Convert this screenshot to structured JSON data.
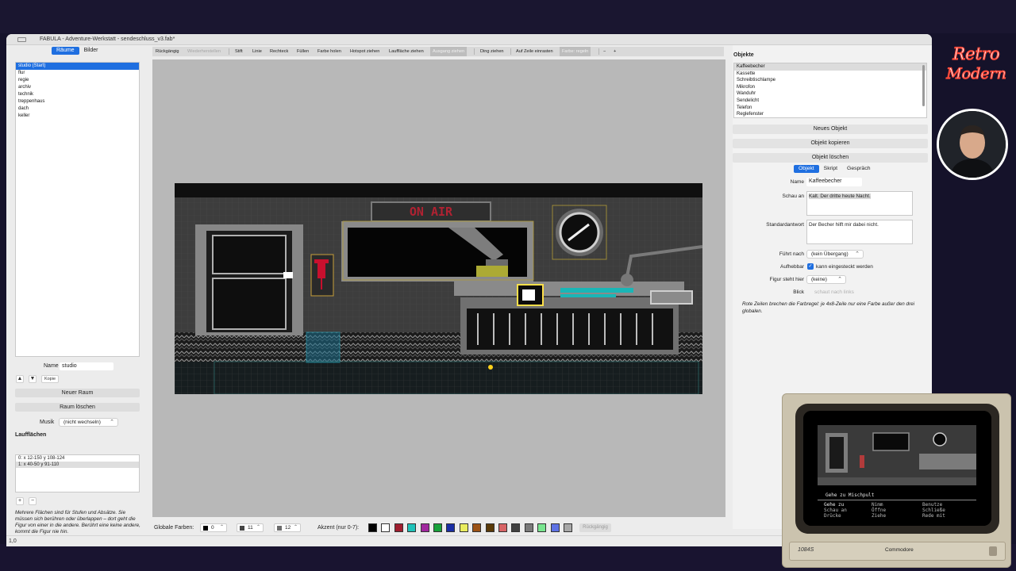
{
  "window": {
    "title": "FABULA - Adventure-Werkstatt - sendeschluss_v3.fab*"
  },
  "left_panel": {
    "tabs": [
      "Räume",
      "Bilder"
    ],
    "rooms": [
      "studio  (Start)",
      "flur",
      "regie",
      "archiv",
      "technik",
      "treppenhaus",
      "dach",
      "keller"
    ],
    "name_label": "Name",
    "name_value": "studio",
    "up_button": "▲",
    "down_button": "▼",
    "copy_button": "Kopie",
    "new_room_button": "Neuer Raum",
    "delete_room_button": "Raum löschen",
    "music_label": "Musik",
    "music_value": "(nicht wechseln)",
    "walkareas_title": "Laufflächen",
    "walkareas": [
      "0:  x 12-150   y 108-124",
      "1:  x 40-50   y 91-110"
    ],
    "add_area": "+",
    "remove_area": "−",
    "help_text": "Mehrere Flächen sind für Stufen und Absätze. Sie müssen sich berühren oder überlappen – dort geht die Figur von einer in die andere. Berührt eine keine andere, kommt die Figur nie hin."
  },
  "toolbar": {
    "undo": "Rückgängig",
    "redo": "Wiederherstellen",
    "tools": [
      "Stift",
      "Linie",
      "Rechteck",
      "Füllen",
      "Farbe holen",
      "Hotspot ziehen",
      "Lauffläche ziehen",
      "Ausgang ziehen"
    ],
    "drag_object": "Ding ziehen",
    "fit_row": "Auf Zeile einrasten",
    "color_rule": "Farbe: regeln",
    "zoom_out": "−",
    "zoom_in": "+"
  },
  "scene": {
    "sign_text": "ON AIR"
  },
  "bottom_bar": {
    "global_colors_label": "Globale Farben:",
    "global_colors": [
      {
        "value": "0",
        "color": "#000000"
      },
      {
        "value": "11",
        "color": "#444444"
      },
      {
        "value": "12",
        "color": "#6c6c6c"
      }
    ],
    "accent_label": "Akzent (nur 0-7):",
    "palette": [
      "#000000",
      "#ffffff",
      "#9f1d2e",
      "#1fc2b9",
      "#a0289e",
      "#18a13b",
      "#1a2ea4",
      "#e9ec5f",
      "#9c5215",
      "#5a3a08",
      "#d86466",
      "#414141",
      "#7a7a7a",
      "#78e58f",
      "#5e72e4",
      "#a8a8a8"
    ],
    "reset_button": "Rückgängig"
  },
  "right_panel": {
    "objects_title": "Objekte",
    "objects": [
      "Kaffeebecher",
      "Kassette",
      "Schreibtischlampe",
      "Mikrofon",
      "Wanduhr",
      "Sendelicht",
      "Telefon",
      "Reglefenster"
    ],
    "new_object": "Neues Objekt",
    "copy_object": "Objekt kopieren",
    "delete_object": "Objekt löschen",
    "tabs": [
      "Objekt",
      "Skript",
      "Gespräch"
    ],
    "name_label": "Name",
    "name_value": "Kaffeebecher",
    "look_label": "Schau an",
    "look_value": "Kalt. Der dritte heute Nacht.",
    "default_label": "Standardantwort",
    "default_value": "Der Becher hilft mir dabei nicht.",
    "leads_label": "Führt nach",
    "leads_value": "(kein Übergang)",
    "pickup_label": "Aufhebbar",
    "pickup_text": "kann eingesteckt werden",
    "figure_label": "Figur steht hier",
    "figure_value": "(keine)",
    "view_label": "Blick",
    "view_value": "schaut nach links",
    "note": "Rote Zeilen brechen die Farbregel: je 4x8-Zeile nur eine Farbe außer den drei globalen."
  },
  "status_bar": {
    "zoom": "1,0"
  },
  "overlay": {
    "logo_line1": "Retro",
    "logo_line2": "Modern",
    "c64_model": "1084S",
    "c64_brand": "Commodore",
    "crt_command": "Gehe zu Mischpult",
    "crt_verbs": [
      "Gehe zu",
      "Nimm",
      "Benutze",
      "Schau an",
      "Öffne",
      "Schließe",
      "Drücke",
      "Ziehe",
      "Rede mit"
    ]
  }
}
